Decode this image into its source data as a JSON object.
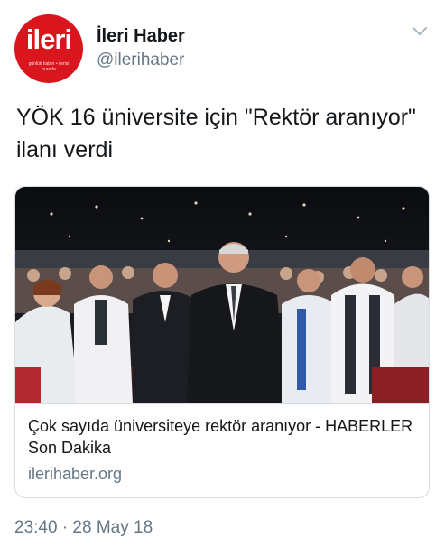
{
  "account": {
    "display_name": "İleri Haber",
    "handle": "@ilerihaber",
    "avatar": {
      "logo_text": "ileri",
      "tagline": "günlük haber • ilerisi burada",
      "bg_color": "#d9151d"
    }
  },
  "menu": {
    "icon": "chevron-down-icon"
  },
  "tweet": {
    "text": "YÖK 16 üniversite için \"Rektör aranıyor\" ilanı verdi"
  },
  "card": {
    "title": "Çok sayıda üniversiteye rektör aranıyor - HABERLER Son Dakika",
    "domain": "ilerihaber.org"
  },
  "meta": {
    "timestamp": "23:40 · 28 May 18"
  }
}
